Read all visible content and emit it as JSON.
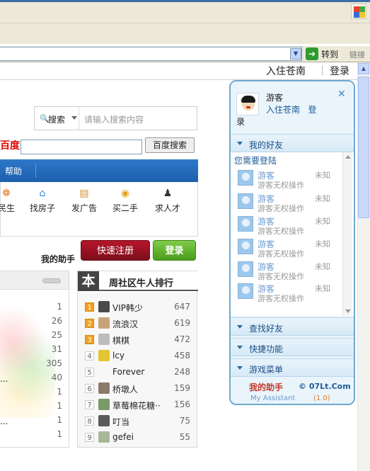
{
  "browser": {
    "go_label": "转到",
    "links_label": "链接"
  },
  "topnav": {
    "link1": "入住苍南",
    "link2": "登录"
  },
  "search": {
    "type_label": "搜索",
    "placeholder": "请输入搜索内容"
  },
  "baidu": {
    "logo_text": "百度",
    "button_label": "百度搜索"
  },
  "menu": {
    "help": "帮助"
  },
  "icon_row": [
    {
      "label": "民生",
      "icon": "people-icon"
    },
    {
      "label": "找房子",
      "icon": "house-icon"
    },
    {
      "label": "发广告",
      "icon": "document-icon"
    },
    {
      "label": "买二手",
      "icon": "money-bag-icon"
    },
    {
      "label": "求人才",
      "icon": "person-suit-icon"
    }
  ],
  "helper": {
    "label": "我的助手",
    "register": "快速注册",
    "login": "登录"
  },
  "left_list": {
    "values": [
      "1",
      "26",
      "25",
      "31",
      "305",
      "40",
      "1",
      "1",
      "1",
      "1"
    ],
    "fragments": [
      "",
      "",
      "",
      "",
      "",
      "...",
      "",
      "...",
      "",
      ""
    ]
  },
  "ranking": {
    "badge": "本",
    "title": "周社区牛人排行",
    "rows": [
      {
        "rank": "1",
        "name": "VIP韩少",
        "score": "647"
      },
      {
        "rank": "2",
        "name": "流浪汉",
        "score": "619"
      },
      {
        "rank": "3",
        "name": "棋棋",
        "score": "472"
      },
      {
        "rank": "4",
        "name": "lcy",
        "score": "458"
      },
      {
        "rank": "5",
        "name": "Forever",
        "score": "248"
      },
      {
        "rank": "6",
        "name": "桥墩人",
        "score": "159"
      },
      {
        "rank": "7",
        "name": "草莓棉花糖··",
        "score": "156"
      },
      {
        "rank": "8",
        "name": "叮当",
        "score": "75"
      },
      {
        "rank": "9",
        "name": "gefei",
        "score": "55"
      }
    ]
  },
  "assistant": {
    "guest": "游客",
    "link_join": "入住苍南",
    "link_login_part1": "登",
    "link_login_part2": "录",
    "sections": {
      "friends": "我的好友",
      "find": "查找好友",
      "shortcuts": "快捷功能",
      "games": "游戏菜单"
    },
    "need_login": "您需要登陆",
    "friends": [
      {
        "name": "游客",
        "status": "未知",
        "desc": "游客无权操作"
      },
      {
        "name": "游客",
        "status": "未知",
        "desc": "游客无权操作"
      },
      {
        "name": "游客",
        "status": "未知",
        "desc": "游客无权操作"
      },
      {
        "name": "游客",
        "status": "未知",
        "desc": "游客无权操作"
      },
      {
        "name": "游客",
        "status": "未知",
        "desc": "游客无权操作"
      },
      {
        "name": "游客",
        "status": "未知",
        "desc": "游客无权操作"
      }
    ],
    "footer": {
      "title": "我的助手",
      "site": "© 07Lt.Com",
      "en": "My Assistant",
      "version": "(1.0)"
    }
  }
}
